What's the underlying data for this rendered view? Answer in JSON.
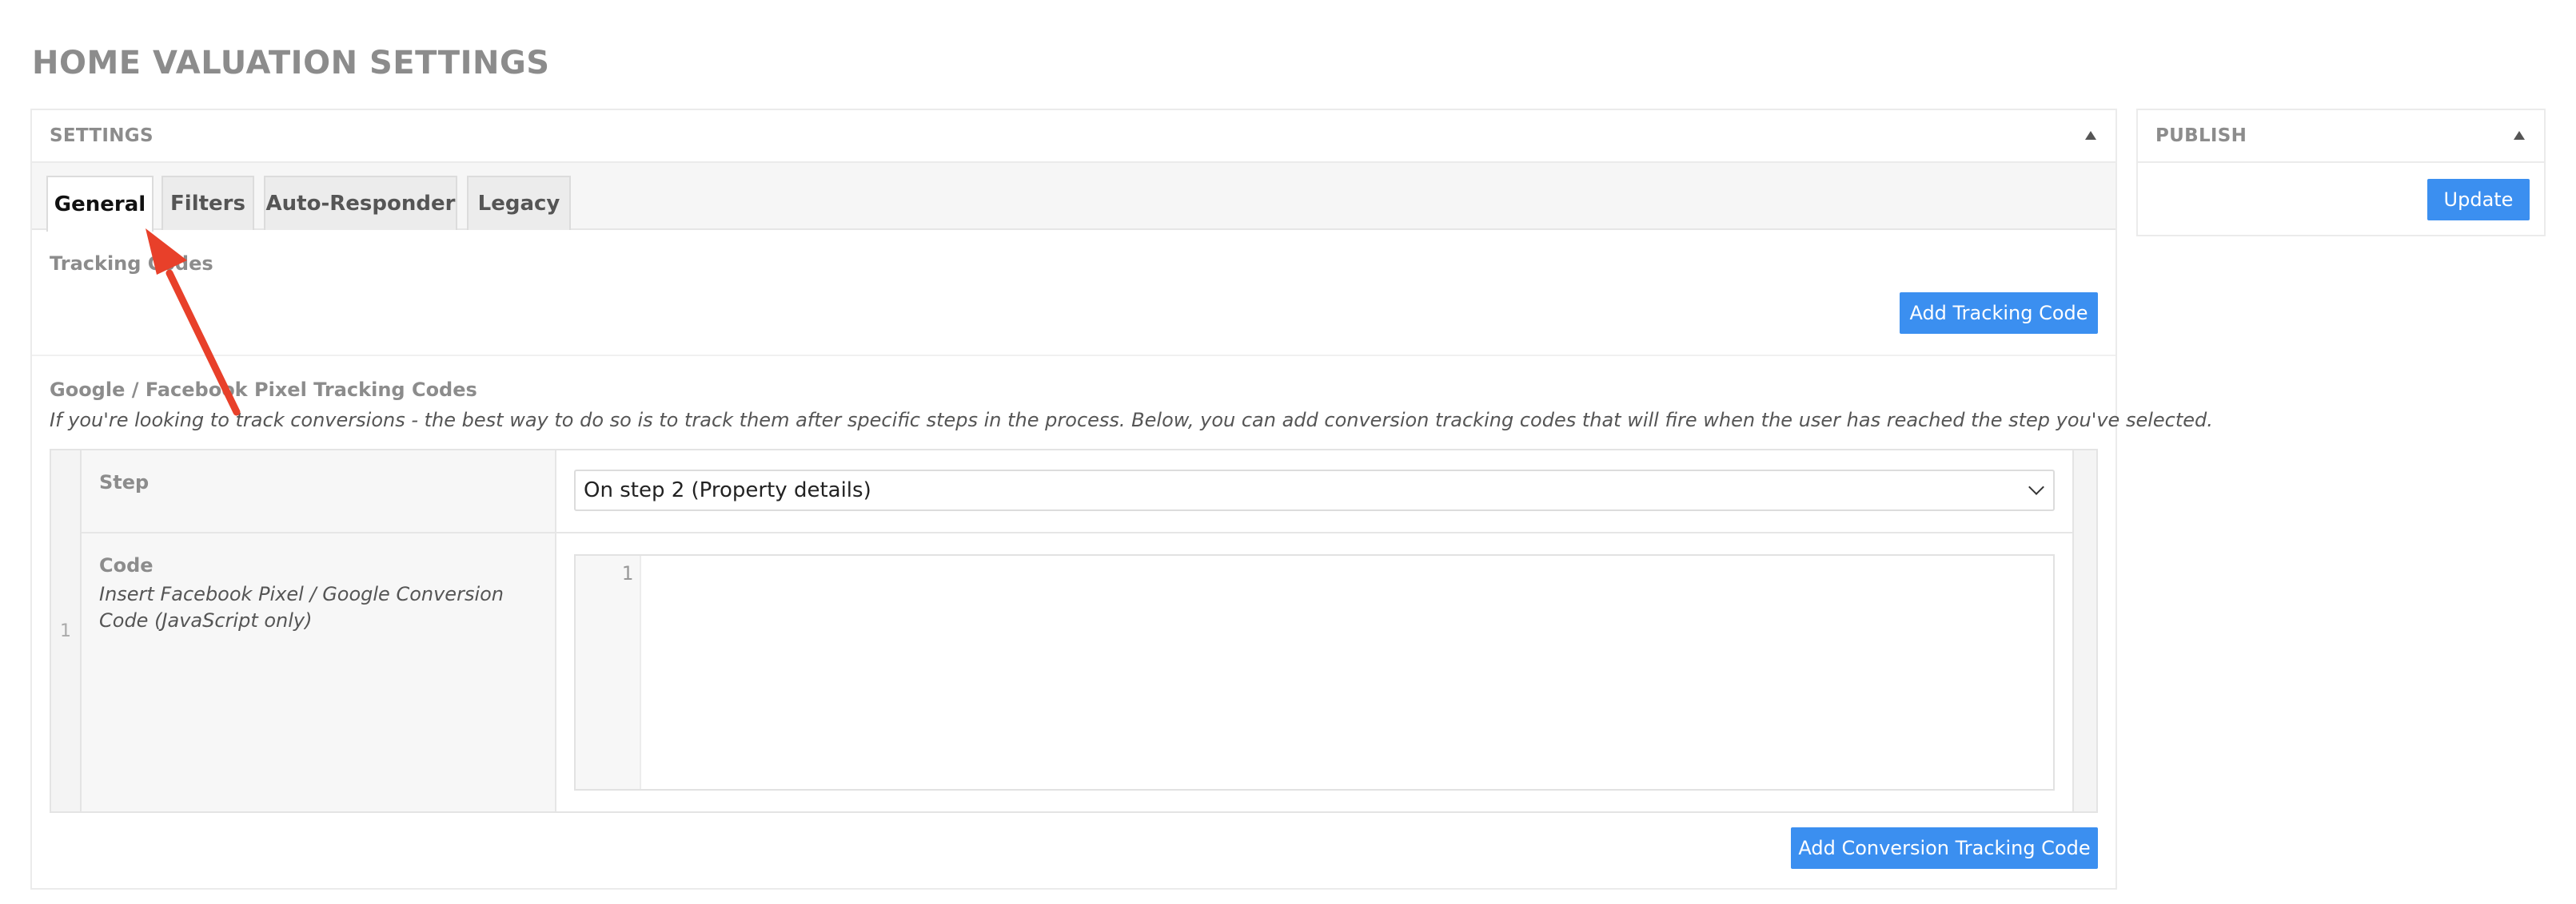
{
  "page": {
    "title": "HOME VALUATION SETTINGS"
  },
  "settings_box": {
    "title": "SETTINGS",
    "tabs": [
      {
        "label": "General",
        "active": true
      },
      {
        "label": "Filters",
        "active": false
      },
      {
        "label": "Auto-Responder",
        "active": false
      },
      {
        "label": "Legacy",
        "active": false
      }
    ],
    "tracking_codes": {
      "label": "Tracking Codes",
      "add_button": "Add Tracking Code"
    },
    "pixel_codes": {
      "label": "Google / Facebook Pixel Tracking Codes",
      "description": "If you're looking to track conversions - the best way to do so is to track them after specific steps in the process. Below, you can add conversion tracking codes that will fire when the user has reached the step you've selected.",
      "rows": [
        {
          "index": "1",
          "step_label": "Step",
          "step_value": "On step 2 (Property details)",
          "code_label": "Code",
          "code_instructions": "Insert Facebook Pixel / Google Conversion Code (JavaScript only)",
          "code_line_number": "1"
        }
      ],
      "add_button": "Add Conversion Tracking Code"
    }
  },
  "publish_box": {
    "title": "PUBLISH",
    "update_button": "Update"
  },
  "colors": {
    "accent": "#3b8ff0",
    "annotation": "#e8402a"
  },
  "icons": {
    "collapse": "triangle-up-icon",
    "select": "chevron-down-icon",
    "annotation": "red-arrow-annotation"
  }
}
